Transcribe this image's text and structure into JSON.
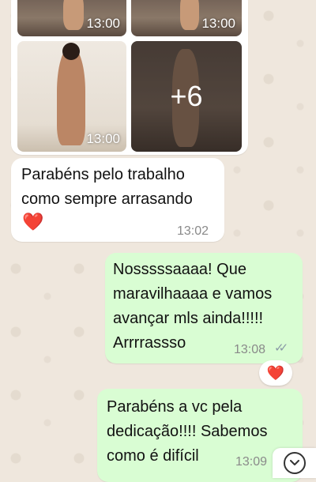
{
  "media_album": {
    "photo_times": [
      "13:00",
      "13:00",
      "13:00"
    ],
    "more_count": "+6"
  },
  "messages": [
    {
      "direction": "incoming",
      "text_lines": [
        "Parabéns pelo trabalho",
        "como sempre arrasando"
      ],
      "emoji": "❤️",
      "time": "13:02"
    },
    {
      "direction": "outgoing",
      "text_lines": [
        "Nosssssaaaa! Que",
        "maravilhaaaa e vamos",
        "avançar mls ainda!!!!!",
        "Arrrrassso"
      ],
      "time": "13:08",
      "status": "read",
      "reaction": "❤️"
    },
    {
      "direction": "outgoing",
      "text_lines": [
        "Parabéns a vc pela",
        "dedicação!!!! Sabemos",
        "como é difícil"
      ],
      "time": "13:09"
    }
  ],
  "colors": {
    "chat_background": "#efe7dd",
    "incoming_bubble": "#ffffff",
    "outgoing_bubble": "#d9fdd3",
    "read_ticks": "#8a9aa6",
    "heart": "#e0222d"
  },
  "icons": {
    "scroll_down": "chevron-down-icon",
    "read_receipt": "double-check-icon"
  }
}
